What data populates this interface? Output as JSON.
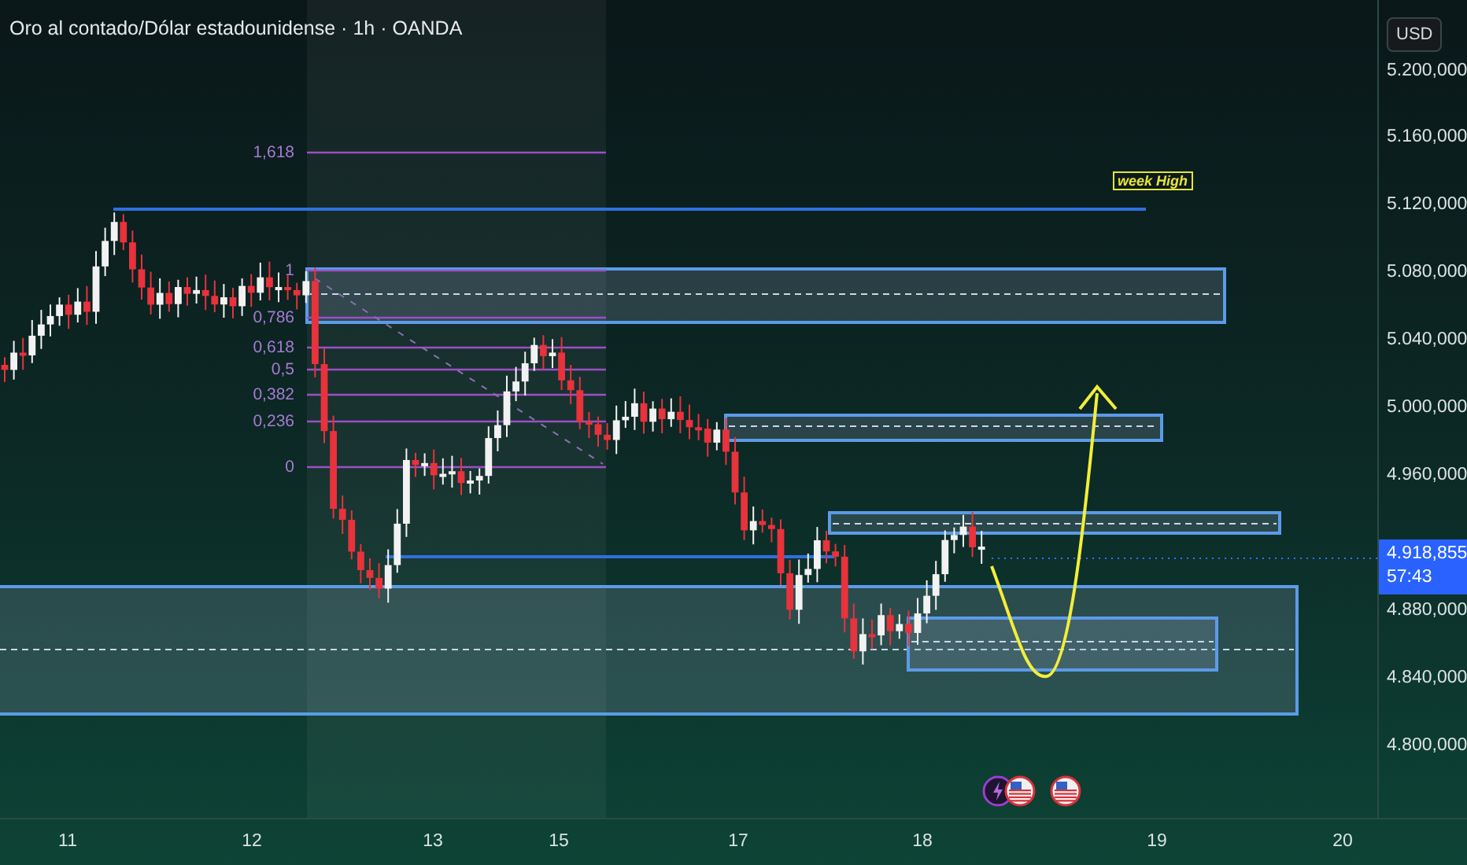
{
  "chart": {
    "title": "Oro al contado/Dólar estadounidense · 1h · OANDA",
    "fib_levels": [
      "1,618",
      "1",
      "0,786",
      "0,618",
      "0,5",
      "0,382",
      "0,236",
      "0"
    ],
    "annotation": "week High",
    "event_markers": [
      {
        "kind": "lightning"
      },
      {
        "kind": "us-flag"
      },
      {
        "kind": "us-flag"
      }
    ]
  },
  "price_axis": {
    "currency": "USD",
    "ticks": [
      "5.200,000",
      "5.160,000",
      "5.120,000",
      "5.080,000",
      "5.040,000",
      "5.000,000",
      "4.960,000",
      "4.880,000",
      "4.840,000",
      "4.800,000"
    ],
    "current_price": "4.918,855",
    "countdown": "57:43"
  },
  "time_axis": {
    "ticks": [
      "11",
      "12",
      "13",
      "15",
      "17",
      "18",
      "19",
      "20"
    ]
  }
}
